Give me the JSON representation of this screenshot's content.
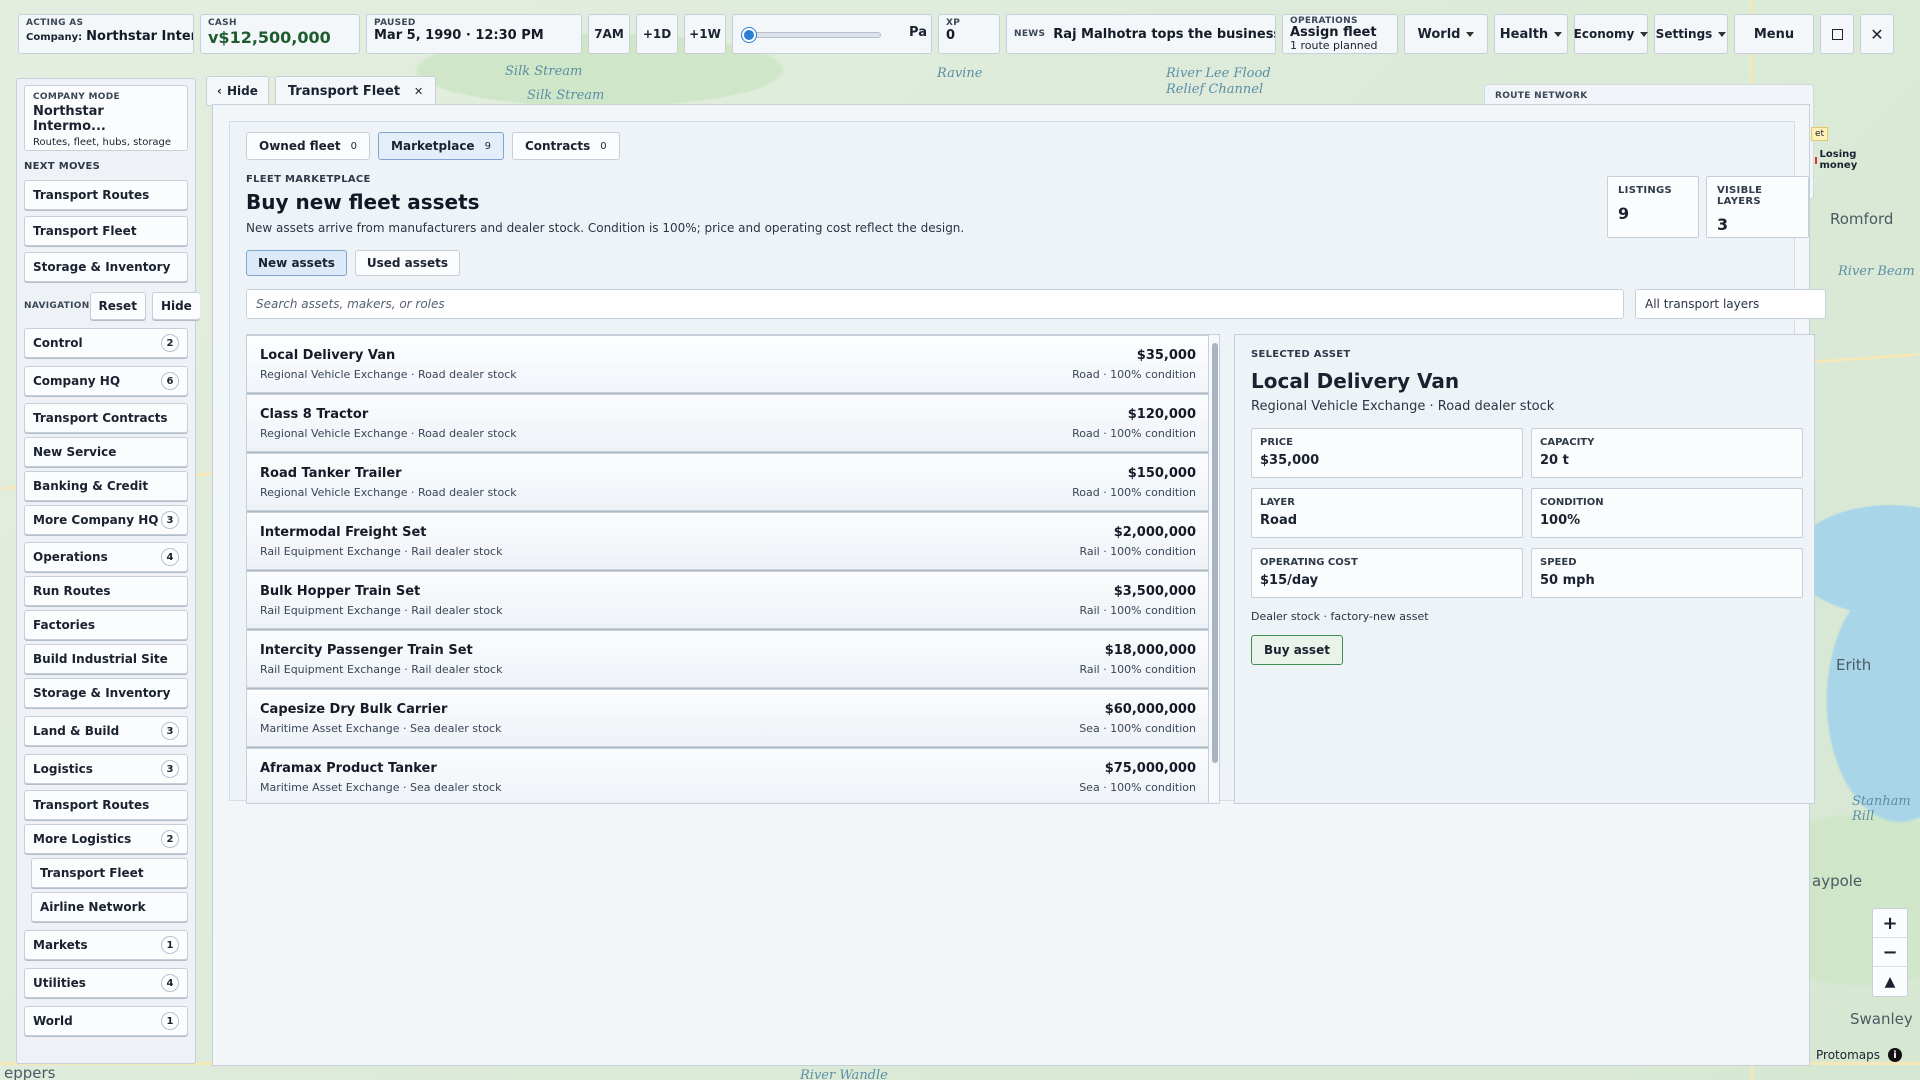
{
  "topbar": {
    "acting": {
      "caption": "Acting as",
      "label": "Company:",
      "value": "Northstar Inter..."
    },
    "cash": {
      "caption": "Cash",
      "value": "v$12,500,000"
    },
    "time": {
      "caption": "Paused",
      "value": "Mar 5, 1990 · 12:30 PM"
    },
    "buttons": [
      "7AM",
      "+1D",
      "+1W"
    ],
    "speed": {
      "fill": 0.0,
      "label": "Pa"
    },
    "xp": {
      "caption": "XP",
      "value": "0"
    },
    "news": {
      "caption": "News",
      "value": "Raj Malhotra tops the business rank"
    },
    "operations": {
      "caption": "Operations",
      "value": "Assign fleet",
      "sub": "1 route planned"
    },
    "menus": [
      "World",
      "Health",
      "Economy",
      "Settings"
    ],
    "menu_button": "Menu"
  },
  "sidebar": {
    "company": {
      "caption": "Company mode",
      "name": "Northstar Intermo...",
      "sub": "Routes, fleet, hubs, storage"
    },
    "next_title": "Next moves",
    "next_moves": [
      "Transport Routes",
      "Transport Fleet",
      "Storage & Inventory"
    ],
    "nav_title": "Navigation",
    "reset": "Reset",
    "hide": "Hide",
    "items": [
      {
        "label": "Control",
        "badge": "2"
      },
      {
        "label": "Company HQ",
        "badge": "6"
      },
      {
        "label": "Transport Contracts",
        "badge": ""
      },
      {
        "label": "New Service",
        "badge": ""
      },
      {
        "label": "Banking & Credit",
        "badge": ""
      },
      {
        "label": "More Company HQ",
        "badge": "3"
      },
      {
        "label": "Operations",
        "badge": "4"
      },
      {
        "label": "Run Routes",
        "badge": ""
      },
      {
        "label": "Factories",
        "badge": ""
      },
      {
        "label": "Build Industrial Site",
        "badge": ""
      },
      {
        "label": "Storage & Inventory",
        "badge": ""
      },
      {
        "label": "Land & Build",
        "badge": "3"
      },
      {
        "label": "Logistics",
        "badge": "3"
      },
      {
        "label": "Transport Routes",
        "badge": ""
      },
      {
        "label": "More Logistics",
        "badge": "2"
      },
      {
        "label": "Transport Fleet",
        "badge": ""
      },
      {
        "label": "Airline Network",
        "badge": ""
      },
      {
        "label": "Markets",
        "badge": "1"
      },
      {
        "label": "Utilities",
        "badge": "4"
      },
      {
        "label": "World",
        "badge": "1"
      }
    ]
  },
  "tabs": {
    "hide": "Hide",
    "active": "Transport Fleet"
  },
  "subtabs": [
    {
      "label": "Owned fleet",
      "count": "0"
    },
    {
      "label": "Marketplace",
      "count": "9"
    },
    {
      "label": "Contracts",
      "count": "0"
    }
  ],
  "marketplace": {
    "eyebrow": "Fleet marketplace",
    "title": "Buy new fleet assets",
    "description": "New assets arrive from manufacturers and dealer stock. Condition is 100%; price and operating cost reflect the design.",
    "stats": [
      {
        "label": "Listings",
        "value": "9"
      },
      {
        "label": "Visible layers",
        "value": "3"
      }
    ],
    "toggles": [
      "New assets",
      "Used assets"
    ],
    "search_placeholder": "Search assets, makers, or roles",
    "layer_filter": "All transport layers",
    "listings": [
      {
        "name": "Local Delivery Van",
        "source": "Regional Vehicle Exchange · Road dealer stock",
        "price": "$35,000",
        "cond": "Road · 100% condition"
      },
      {
        "name": "Class 8 Tractor",
        "source": "Regional Vehicle Exchange · Road dealer stock",
        "price": "$120,000",
        "cond": "Road · 100% condition"
      },
      {
        "name": "Road Tanker Trailer",
        "source": "Regional Vehicle Exchange · Road dealer stock",
        "price": "$150,000",
        "cond": "Road · 100% condition"
      },
      {
        "name": "Intermodal Freight Set",
        "source": "Rail Equipment Exchange · Rail dealer stock",
        "price": "$2,000,000",
        "cond": "Rail · 100% condition"
      },
      {
        "name": "Bulk Hopper Train Set",
        "source": "Rail Equipment Exchange · Rail dealer stock",
        "price": "$3,500,000",
        "cond": "Rail · 100% condition"
      },
      {
        "name": "Intercity Passenger Train Set",
        "source": "Rail Equipment Exchange · Rail dealer stock",
        "price": "$18,000,000",
        "cond": "Rail · 100% condition"
      },
      {
        "name": "Capesize Dry Bulk Carrier",
        "source": "Maritime Asset Exchange · Sea dealer stock",
        "price": "$60,000,000",
        "cond": "Sea · 100% condition"
      },
      {
        "name": "Aframax Product Tanker",
        "source": "Maritime Asset Exchange · Sea dealer stock",
        "price": "$75,000,000",
        "cond": "Sea · 100% condition"
      }
    ]
  },
  "selected": {
    "eyebrow": "Selected asset",
    "name": "Local Delivery Van",
    "source": "Regional Vehicle Exchange · Road dealer stock",
    "fields": [
      {
        "k": "Price",
        "v": "$35,000"
      },
      {
        "k": "Capacity",
        "v": "20 t"
      },
      {
        "k": "Layer",
        "v": "Road"
      },
      {
        "k": "Condition",
        "v": "100%"
      },
      {
        "k": "Operating cost",
        "v": "$15/day"
      },
      {
        "k": "Speed",
        "v": "50 mph"
      }
    ],
    "note": "Dealer stock · factory-new asset",
    "buy": "Buy asset"
  },
  "overlay": {
    "route_network": "Route Network",
    "losing": "Losing money",
    "tag": "et"
  },
  "map_labels": [
    "Silk Stream",
    "Silk Stream",
    "Ravine",
    "River Lee Flood Relief Channel",
    "Romford",
    "River Beam",
    "Erith",
    "Stanham Rill",
    "Swanley",
    "aypole",
    "River Wandle",
    "eppers"
  ],
  "attribution": "Protomaps",
  "accent": "#2a7fd4",
  "buy_color": "#3f8f55"
}
